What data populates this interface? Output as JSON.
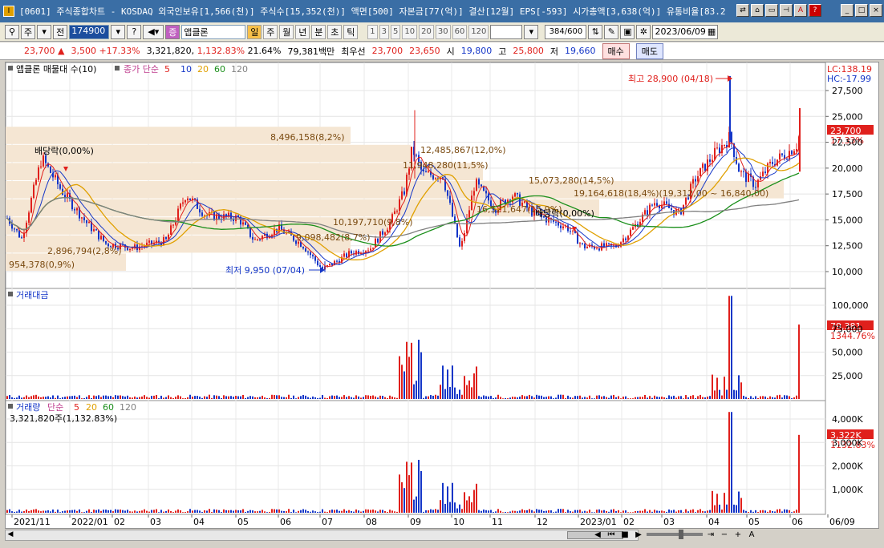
{
  "titlebar": {
    "title": "[0601] 주식종합차트 - KOSDAQ 외국인보유[1,566(천)] 주식수[15,352(천)] 액면[500] 자본금[77(억)] 결산[12월] EPS[-593] 시가총액[3,638(억)] 유통비율[83.2"
  },
  "toolbar": {
    "market": "주",
    "prev": "전",
    "code": "174900",
    "stock_name": "앱클론",
    "periods": [
      "일",
      "주",
      "월",
      "년",
      "분",
      "초",
      "틱"
    ],
    "active_period": "일",
    "numbers": [
      "1",
      "3",
      "5",
      "10",
      "20",
      "30",
      "60",
      "120"
    ],
    "count": "384",
    "total": "/600",
    "date": "2023/06/09"
  },
  "quote": {
    "price": "23,700",
    "arrow": "▲",
    "change": "3,500",
    "change_pct": "+17.33%",
    "volume": "3,321,820",
    "volume_pct": "1,132.83%",
    "turnover": "21.64%",
    "amount": "79,381백만",
    "best_label": "최우선",
    "ask": "23,700",
    "bid": "23,650",
    "open_label": "시",
    "open": "19,800",
    "high_label": "고",
    "high": "25,800",
    "low_label": "저",
    "low": "19,660",
    "buy": "매수",
    "sell": "매도"
  },
  "panels": {
    "price": {
      "title": "앱클론 매물대 수(10)",
      "ma_label": "종가 단순",
      "ma": [
        "5",
        "10",
        "20",
        "60",
        "120"
      ],
      "ma_colors": [
        "#e0201c",
        "#1436c8",
        "#e0a000",
        "#1a8f1a",
        "#808080"
      ],
      "lc": "LC:138.19",
      "hc": "HC:-17.99",
      "current_price": "23,700",
      "current_pct": "17.33%",
      "high_note": "최고 28,900 (04/18)",
      "low_note": "최저 9,950 (07/04)",
      "dividend": "배당락(0,00%)",
      "dividend2": "배당락(0,00%)",
      "profile_labels": [
        {
          "text": "8,496,158(8,2%)"
        },
        {
          "text": "12,485,867(12,0%)"
        },
        {
          "text": "11,948,280(11,5%)"
        },
        {
          "text": "15,073,280(14,5%)"
        },
        {
          "text": "19,164,618(18,4%)(19,312,00 ~ 16,840,00)"
        },
        {
          "text": "16,521,647(15,9%)"
        },
        {
          "text": "10,197,710(9,8%)"
        },
        {
          "text": "9,098,482(8,7%)"
        },
        {
          "text": "2,896,794(2,8%)"
        },
        {
          "text": "954,378(0,9%)"
        }
      ],
      "yticks": [
        "27,500",
        "25,000",
        "22,500",
        "20,000",
        "17,500",
        "15,000",
        "12,500",
        "10,000"
      ]
    },
    "amount": {
      "title": "거래대금",
      "current": "79,381",
      "current_pct": "1344.76%",
      "yticks": [
        "100,000",
        "75,000",
        "50,000",
        "25,000"
      ]
    },
    "volume": {
      "title": "거래량",
      "ma_label": "단순",
      "ma": [
        "5",
        "20",
        "60",
        "120"
      ],
      "sub": "3,321,820주(1,132.83%)",
      "current": "3,322K",
      "current_pct": "1132.83%",
      "yticks": [
        "4,000K",
        "3,000K",
        "2,000K",
        "1,000K"
      ]
    }
  },
  "xaxis": [
    "2021/11",
    "2022/01",
    "02",
    "03",
    "04",
    "05",
    "06",
    "07",
    "08",
    "09",
    "10",
    "11",
    "12",
    "2023/01",
    "02",
    "03",
    "04",
    "05",
    "06",
    "06/09"
  ]
}
